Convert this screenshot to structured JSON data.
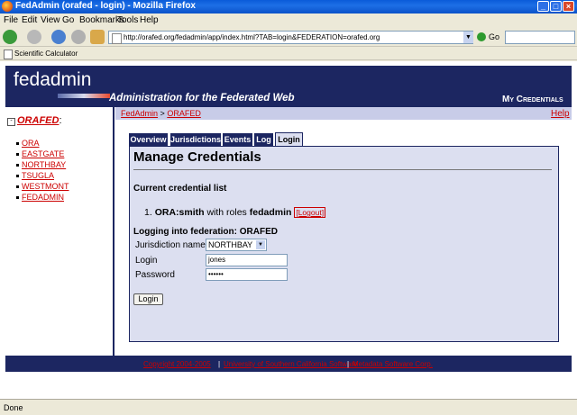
{
  "window": {
    "title": "FedAdmin (orafed - login) - Mozilla Firefox",
    "min_glyph": "_",
    "max_glyph": "□",
    "close_glyph": "×"
  },
  "menu": [
    "File",
    "Edit",
    "View",
    "Go",
    "Bookmarks",
    "Tools",
    "Help"
  ],
  "toolbar": {
    "url": "http://orafed.org/fedadmin/app/index.html?TAB=login&FEDERATION=orafed.org",
    "url_dropdown_glyph": "▼",
    "go_label": "Go",
    "search_value": ""
  },
  "bookmarks": [
    "Scientific Calculator"
  ],
  "page": {
    "logo": "fedadmin",
    "tagline": "Administration for the Federated Web",
    "header_right": "My Credentials",
    "breadcrumb": {
      "root": "FedAdmin",
      "sep": ">",
      "current": "ORAFED"
    },
    "help": "Help",
    "sidebar": {
      "toggle_glyph": "-",
      "title": "ORAFED",
      "colon": ":",
      "items": [
        "ORA",
        "EASTGATE",
        "NORTHBAY",
        "TSUGLA",
        "WESTMONT",
        "FEDADMIN"
      ]
    },
    "tabs": [
      "Overview",
      "Jurisdictions",
      "Events",
      "Log",
      "Login"
    ],
    "active_tab": "Login",
    "panel": {
      "title": "Manage Credentials",
      "current_list_heading": "Current credential list",
      "credential": {
        "index": "1.",
        "user": "ORA:smith",
        "with_roles": "with roles",
        "role": "fedadmin",
        "logout": "[Logout]"
      },
      "login_heading": "Logging into federation: ORAFED",
      "jurisdiction_label": "Jurisdiction name",
      "jurisdiction_value": "NORTHBAY",
      "select_glyph": "▼",
      "login_label": "Login",
      "login_value": "jones",
      "password_label": "Password",
      "password_value": "••••••",
      "submit": "Login"
    },
    "footer": {
      "copyright": "Copyright 2004-2005",
      "sep1": "|",
      "middle": "University of Southern California Software",
      "sep2": "|",
      "company": "Metadata Software Corp."
    }
  },
  "status": {
    "text": "Done"
  },
  "colors": {
    "header": "#1c2661",
    "link": "#cc0000",
    "panel": "#dcdff0",
    "bar": "#c8cce8"
  }
}
